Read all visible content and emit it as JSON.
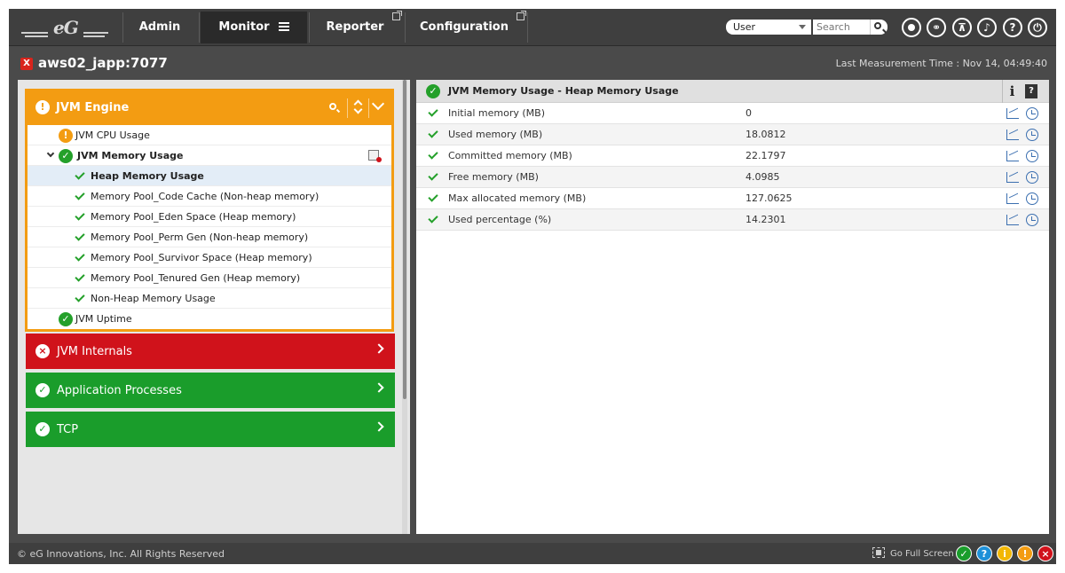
{
  "nav": {
    "logo_text": "eG",
    "items": [
      {
        "label": "Admin"
      },
      {
        "label": "Monitor"
      },
      {
        "label": "Reporter"
      },
      {
        "label": "Configuration"
      }
    ],
    "user_select": "User",
    "search_placeholder": "Search",
    "round_icons": [
      "user-icon",
      "link-icon",
      "alert-filter-icon",
      "bell-icon",
      "help-icon",
      "power-icon"
    ]
  },
  "titlebar": {
    "title": "aws02_japp:7077",
    "measurement": "Last Measurement Time : Nov 14, 04:49:40"
  },
  "left": {
    "section_title": "JVM Engine",
    "tree": [
      {
        "label": "JVM CPU Usage",
        "status": "warn"
      },
      {
        "label": "JVM Memory Usage",
        "status": "ok"
      },
      {
        "label": "Heap Memory Usage",
        "status": "ok"
      },
      {
        "label": "Memory Pool_Code Cache (Non-heap memory)",
        "status": "ok"
      },
      {
        "label": "Memory Pool_Eden Space (Heap memory)",
        "status": "ok"
      },
      {
        "label": "Memory Pool_Perm Gen (Non-heap memory)",
        "status": "ok"
      },
      {
        "label": "Memory Pool_Survivor Space (Heap memory)",
        "status": "ok"
      },
      {
        "label": "Memory Pool_Tenured Gen (Heap memory)",
        "status": "ok"
      },
      {
        "label": "Non-Heap Memory Usage",
        "status": "ok"
      },
      {
        "label": "JVM Uptime",
        "status": "ok"
      }
    ],
    "collapsed_sections": [
      {
        "label": "JVM Internals",
        "status": "error",
        "color": "#d0121b"
      },
      {
        "label": "Application Processes",
        "status": "ok",
        "color": "#1a9d2b"
      },
      {
        "label": "TCP",
        "status": "ok",
        "color": "#1a9d2b"
      }
    ]
  },
  "right": {
    "title": "JVM Memory Usage - Heap Memory Usage",
    "info_label": "i",
    "help_label": "?",
    "measures": [
      {
        "name": "Initial memory (MB)",
        "value": "0"
      },
      {
        "name": "Used memory (MB)",
        "value": "18.0812"
      },
      {
        "name": "Committed memory (MB)",
        "value": "22.1797"
      },
      {
        "name": "Free memory (MB)",
        "value": "4.0985"
      },
      {
        "name": "Max allocated memory (MB)",
        "value": "127.0625"
      },
      {
        "name": "Used percentage (%)",
        "value": "14.2301"
      }
    ]
  },
  "footer": {
    "copyright": "© eG Innovations, Inc. All Rights Reserved",
    "fullscreen": "Go Full Screen",
    "status_icons": [
      {
        "glyph": "✓",
        "color": "#1a9d2b"
      },
      {
        "glyph": "?",
        "color": "#1e90d8"
      },
      {
        "glyph": "i",
        "color": "#f2b705"
      },
      {
        "glyph": "!",
        "color": "#f39c12"
      },
      {
        "glyph": "×",
        "color": "#d0121b"
      }
    ]
  },
  "colors": {
    "accent_orange": "#f39c12",
    "ok_green": "#24a02a",
    "error_red": "#d0121b"
  }
}
